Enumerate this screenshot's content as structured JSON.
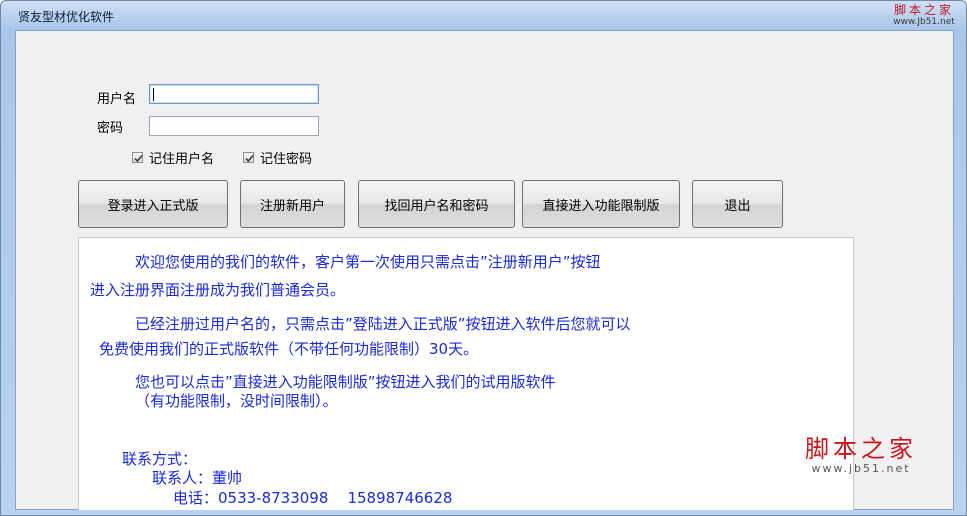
{
  "window": {
    "title": "贤友型材优化软件"
  },
  "watermark": {
    "top_main": "脚本之家",
    "top_sub": "www.Jb51.net",
    "bottom_main": "脚本之家",
    "bottom_sub": "www.jb51.net"
  },
  "login": {
    "username_label": "用户名",
    "username_value": "",
    "password_label": "密码",
    "password_value": "",
    "remember_username": {
      "label": "记住用户名",
      "checked": true
    },
    "remember_password": {
      "label": "记住密码",
      "checked": true
    }
  },
  "buttons": {
    "login_full": "登录进入正式版",
    "register": "注册新用户",
    "recover": "找回用户名和密码",
    "trial": "直接进入功能限制版",
    "exit": "退出"
  },
  "info": {
    "p1_line1": "欢迎您使用的我们的软件，客户第一次使用只需点击”注册新用户”按钮",
    "p1_line2": "进入注册界面注册成为我们普通会员。",
    "p2_line1": "已经注册过用户名的，只需点击”登陆进入正式版”按钮进入软件后您就可以",
    "p2_line2": "免费使用我们的正式版软件（不带任何功能限制）30天。",
    "p3_line1": "您也可以点击”直接进入功能限制版”按钮进入我们的试用版软件",
    "p3_line2": "（有功能限制，没时间限制）。",
    "contact_heading": "联系方式：",
    "contact_person": "联系人：董帅",
    "contact_phone": "电话：0533-8733098    15898746628"
  },
  "colors": {
    "info_text": "#1b2bd6",
    "watermark_red": "#c8151b"
  }
}
